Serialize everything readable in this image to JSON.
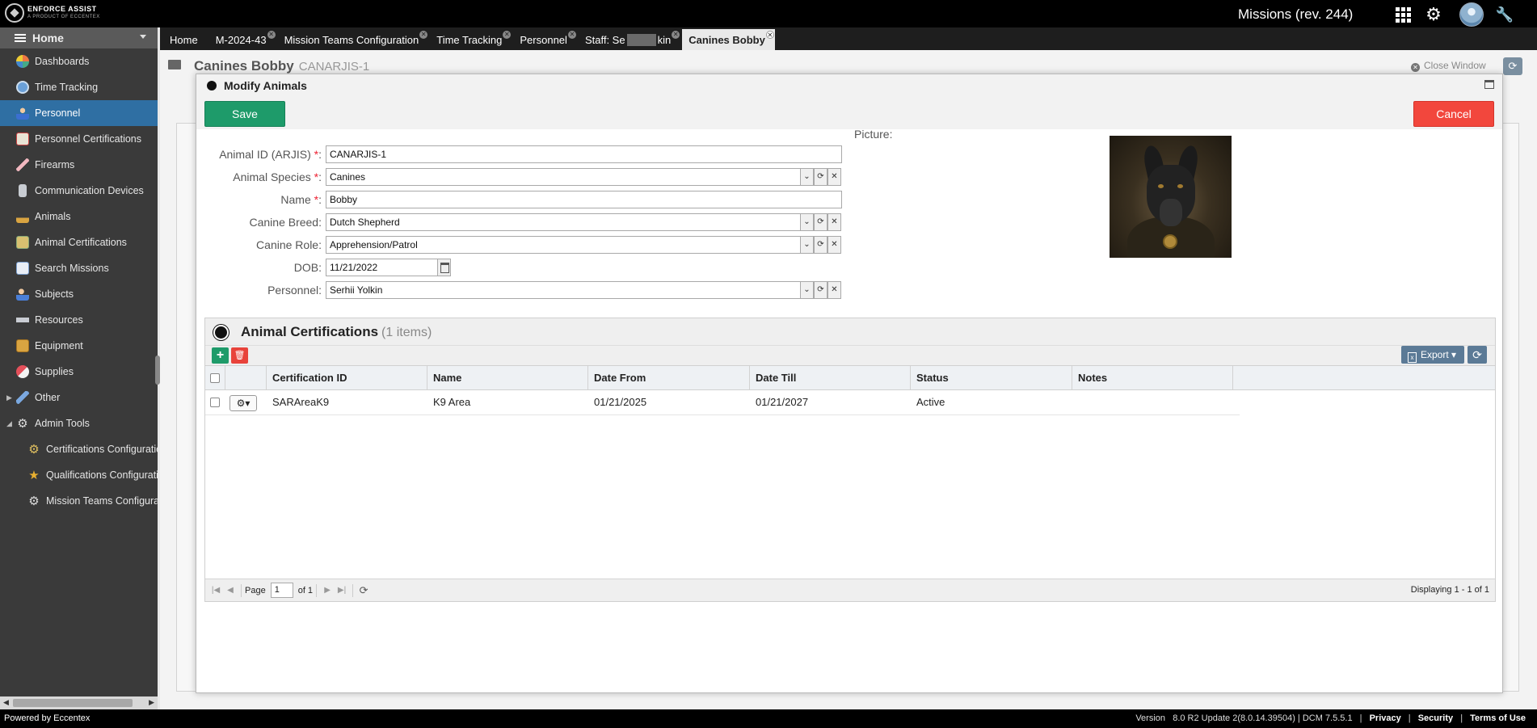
{
  "app": {
    "title": "Missions (rev. 244)",
    "logo_text": "ENFORCE ASSIST",
    "logo_sub": "A PRODUCT OF ECCENTEX"
  },
  "sidebar": {
    "home_label": "Home",
    "items": [
      {
        "label": "Dashboards",
        "icon": "dashboard-icon"
      },
      {
        "label": "Time Tracking",
        "icon": "clock-icon"
      },
      {
        "label": "Personnel",
        "icon": "person-icon"
      },
      {
        "label": "Personnel Certifications",
        "icon": "certificate-icon"
      },
      {
        "label": "Firearms",
        "icon": "firearm-icon"
      },
      {
        "label": "Communication Devices",
        "icon": "radio-icon"
      },
      {
        "label": "Animals",
        "icon": "animal-icon"
      },
      {
        "label": "Animal Certifications",
        "icon": "certificate-icon"
      },
      {
        "label": "Search Missions",
        "icon": "search-missions-icon"
      },
      {
        "label": "Subjects",
        "icon": "subjects-icon"
      },
      {
        "label": "Resources",
        "icon": "resources-icon"
      },
      {
        "label": "Equipment",
        "icon": "equipment-icon"
      },
      {
        "label": "Supplies",
        "icon": "supplies-icon"
      },
      {
        "label": "Other",
        "icon": "tools-icon"
      },
      {
        "label": "Admin Tools",
        "icon": "gear-icon"
      },
      {
        "label": "Certifications Configuratio",
        "icon": "gear-icon"
      },
      {
        "label": "Qualifications Configuratio",
        "icon": "star-icon"
      },
      {
        "label": "Mission Teams Configurat",
        "icon": "gear-icon"
      }
    ]
  },
  "tabs": [
    {
      "label": "Home"
    },
    {
      "label": "M-2024-43"
    },
    {
      "label": "Mission Teams Configuration"
    },
    {
      "label": "Time Tracking"
    },
    {
      "label": "Personnel"
    },
    {
      "label_a": "Staff: Se",
      "label_b": "kin"
    },
    {
      "label": "Canines Bobby"
    }
  ],
  "page": {
    "title": "Canines Bobby",
    "subtitle": "CANARJIS-1",
    "close_window": "Close Window"
  },
  "modal": {
    "title": "Modify Animals",
    "save_label": "Save",
    "cancel_label": "Cancel",
    "picture_label": "Picture:",
    "fields": {
      "animal_id": {
        "label": "Animal ID (ARJIS)",
        "value": "CANARJIS-1"
      },
      "species": {
        "label": "Animal Species",
        "value": "Canines"
      },
      "name": {
        "label": "Name",
        "value": "Bobby"
      },
      "breed": {
        "label": "Canine Breed",
        "value": "Dutch Shepherd"
      },
      "role": {
        "label": "Canine Role",
        "value": "Apprehension/Patrol"
      },
      "dob": {
        "label": "DOB:",
        "value": "11/21/2022"
      },
      "personnel": {
        "label": "Personnel:",
        "value": "Serhii Yolkin"
      }
    }
  },
  "grid": {
    "title": "Animal Certifications",
    "count": "(1 items)",
    "export_label": "Export",
    "columns": [
      "Certification ID",
      "Name",
      "Date From",
      "Date Till",
      "Status",
      "Notes"
    ],
    "rows": [
      {
        "cert_id": "SARAreaK9",
        "name": "K9 Area",
        "date_from": "01/21/2025",
        "date_till": "01/21/2027",
        "status": "Active",
        "notes": ""
      }
    ],
    "pager": {
      "page_label": "Page",
      "page_value": "1",
      "of_label": "of 1",
      "display": "Displaying 1 - 1 of 1"
    }
  },
  "footer": {
    "powered_by": "Powered by Eccentex",
    "version_label": "Version",
    "version_value": "8.0 R2 Update 2(8.0.14.39504) | DCM 7.5.5.1",
    "privacy": "Privacy",
    "security": "Security",
    "terms": "Terms of Use"
  },
  "colors": {
    "accent_blue": "#2f6fa3",
    "save_green": "#1e9b6a",
    "cancel_red": "#f2473d"
  }
}
